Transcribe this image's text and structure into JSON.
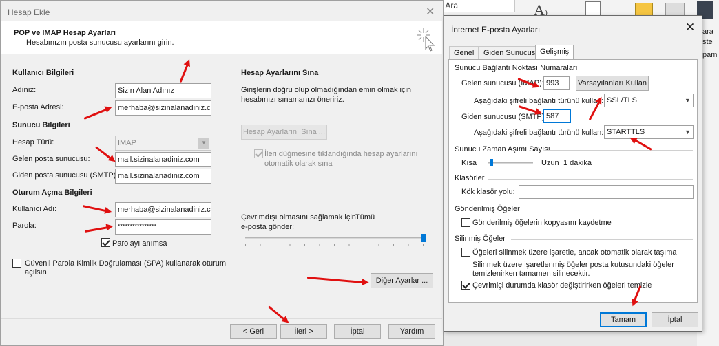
{
  "background": {
    "search_text": "i Ara",
    "right_labels": [
      "ara",
      "ste",
      "pam"
    ]
  },
  "dialog1": {
    "title": "Hesap Ekle",
    "close": "✕",
    "header_title": "POP ve IMAP Hesap Ayarları",
    "header_subtitle": "Hesabınızın posta sunucusu ayarlarını girin.",
    "user_section": "Kullanıcı Bilgileri",
    "name_label": "Adınız:",
    "name_value": "Sizin Alan Adınız",
    "email_label": "E-posta Adresi:",
    "email_value": "merhaba@sizinalanadiniz.com",
    "server_section": "Sunucu Bilgileri",
    "account_type_label": "Hesap Türü:",
    "account_type_value": "IMAP",
    "incoming_label": "Gelen posta sunucusu:",
    "incoming_value": "mail.sizinalanadiniz.com",
    "outgoing_label": "Giden posta sunucusu (SMTP):",
    "outgoing_value": "mail.sizinalanadiniz.com",
    "login_section": "Oturum Açma Bilgileri",
    "username_label": "Kullanıcı Adı:",
    "username_value": "merhaba@sizinalanadiniz.com",
    "password_label": "Parola:",
    "password_value": "****************",
    "remember_label": "Parolayı anımsa",
    "spa_label_line1": "Güvenli Parola Kimlik Doğrulaması (SPA) kullanarak oturum",
    "spa_label_line2": "açılsın",
    "test_section": "Hesap Ayarlarını Sına",
    "test_desc_line1": "Girişlerin doğru olup olmadığından emin olmak için",
    "test_desc_line2": "hesabınızı sınamanızı öneririz.",
    "test_button": "Hesap Ayarlarını Sına ...",
    "auto_test_line1": "İleri düğmesine tıklandığında hesap ayarlarını",
    "auto_test_line2": "otomatik olarak sına",
    "offline_line1": "Çevrimdışı olmasını sağlamak için",
    "offline_line2": "e-posta gönder:",
    "offline_value": "Tümü",
    "offline_level": 1.0,
    "more_settings": "Diğer Ayarlar ...",
    "back_button": "< Geri",
    "next_button": "İleri >",
    "cancel_button": "İptal",
    "help_button": "Yardım"
  },
  "dialog2": {
    "title": "İnternet E-posta Ayarları",
    "close": "✕",
    "tabs": [
      "Genel",
      "Giden Sunucusu",
      "Gelişmiş"
    ],
    "ports_group": "Sunucu Bağlantı Noktası Numaraları",
    "incoming_label": "Gelen sunucusu (IMAP):",
    "incoming_port": "993",
    "defaults_button": "Varsayılanları Kullan",
    "enc_label1": "Aşağıdaki şifreli bağlantı türünü kullan:",
    "enc_value1": "SSL/TLS",
    "outgoing_label": "Giden sunucusu (SMTP):",
    "outgoing_port": "587",
    "enc_label2": "Aşağıdaki şifreli bağlantı türünü kullan:",
    "enc_value2": "STARTTLS",
    "timeout_group": "Sunucu Zaman Aşımı Sayısı",
    "timeout_short": "Kısa",
    "timeout_long": "Uzun",
    "timeout_value": "1 dakika",
    "timeout_level": 0.05,
    "folders_group": "Klasörler",
    "root_folder_label": "Kök klasör yolu:",
    "root_folder_value": "",
    "sent_group": "Gönderilmiş Öğeler",
    "sent_checkbox": "Gönderilmiş öğelerin kopyasını kaydetme",
    "deleted_group": "Silinmiş Öğeler",
    "deleted_checkbox": "Öğeleri silinmek üzere işaretle, ancak otomatik olarak taşıma",
    "deleted_note_line1": "Silinmek üzere işaretlenmiş öğeler posta kutusundaki öğeler",
    "deleted_note_line2": "temizlenirken tamamen silinecektir.",
    "purge_checkbox": "Çevrimiçi durumda klasör değiştirirken öğeleri temizle",
    "ok_button": "Tamam",
    "cancel_button": "İptal"
  },
  "colors": {
    "annotation": "#e01010",
    "accent": "#0078d7"
  }
}
